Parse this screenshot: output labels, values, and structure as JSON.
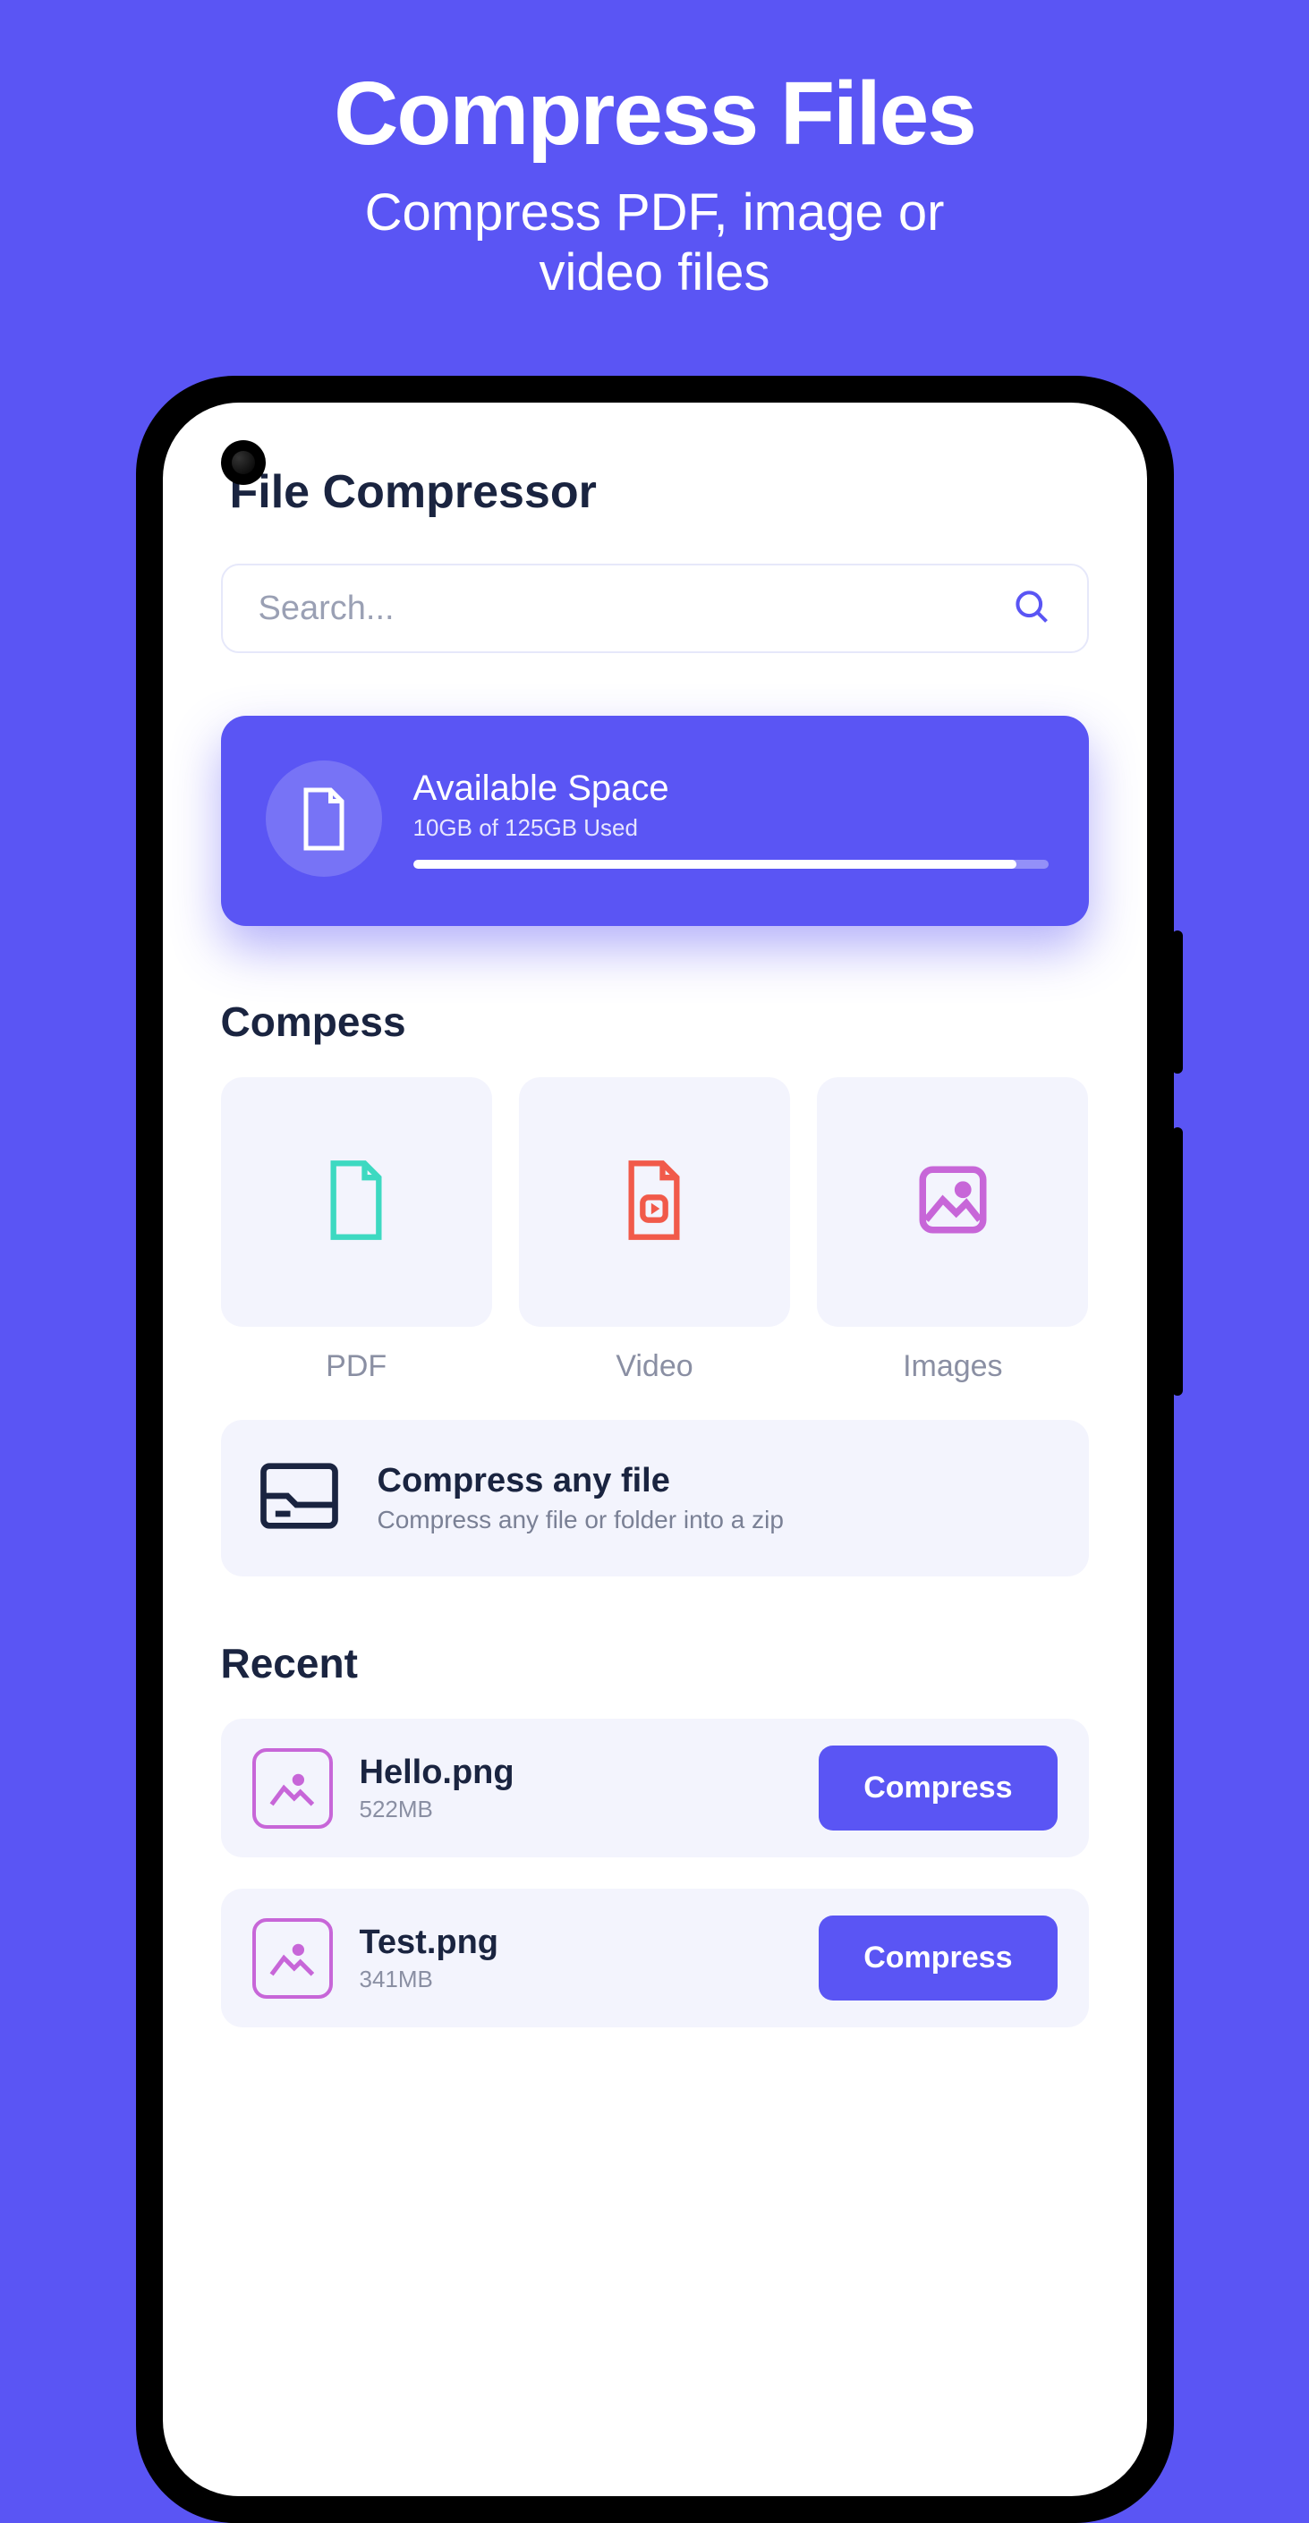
{
  "hero": {
    "title": "Compress Files",
    "subtitle_line1": "Compress PDF, image or",
    "subtitle_line2": "video files"
  },
  "app": {
    "title": "File Compressor"
  },
  "search": {
    "placeholder": "Search..."
  },
  "storage": {
    "title": "Available Space",
    "subtitle": "10GB of 125GB Used"
  },
  "sections": {
    "compress": "Compess",
    "recent": "Recent"
  },
  "tiles": {
    "pdf": "PDF",
    "video": "Video",
    "images": "Images"
  },
  "anyFile": {
    "title": "Compress any file",
    "subtitle": "Compress any file or folder into a zip"
  },
  "recent": [
    {
      "name": "Hello.png",
      "size": "522MB",
      "action": "Compress"
    },
    {
      "name": "Test.png",
      "size": "341MB",
      "action": "Compress"
    }
  ]
}
